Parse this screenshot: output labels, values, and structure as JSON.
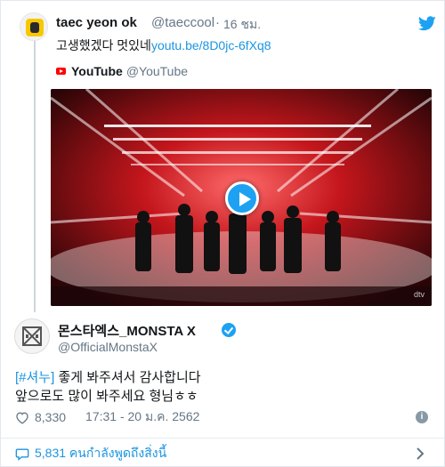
{
  "tweet_parent": {
    "display_name": "taec yeon ok",
    "handle": "@taeccool",
    "separator": "·",
    "time": "16 ชม.",
    "text": "고생했겠다 멋있네",
    "link": "youtu.be/8D0jc-6fXq8",
    "card": {
      "source_name": "YouTube",
      "source_handle": "@YouTube",
      "watermark": "dtv"
    }
  },
  "tweet_reply": {
    "display_name": "몬스타엑스_MONSTA X",
    "handle": "@OfficialMonstaX",
    "hashtag": "[#셔누]",
    "line1_rest": " 좋게 봐주셔서 감사합니다",
    "line2": "앞으로도 많이 봐주세요 형님ㅎㅎ",
    "likes": "8,330",
    "timestamp": "17:31 - 20 ม.ค. 2562",
    "info_glyph": "i"
  },
  "footer": {
    "replies_text": "5,831 คนกำลังพูดถึงสิ่งนี้"
  },
  "colors": {
    "link": "#1b95e0",
    "muted": "#657786",
    "verified": "#1da1f2",
    "youtube": "#ff0000"
  },
  "icons": [
    "twitter-bird-icon",
    "youtube-icon",
    "play-icon",
    "verified-badge-icon",
    "heart-icon",
    "info-icon",
    "chat-bubble-icon",
    "chevron-right-icon"
  ]
}
